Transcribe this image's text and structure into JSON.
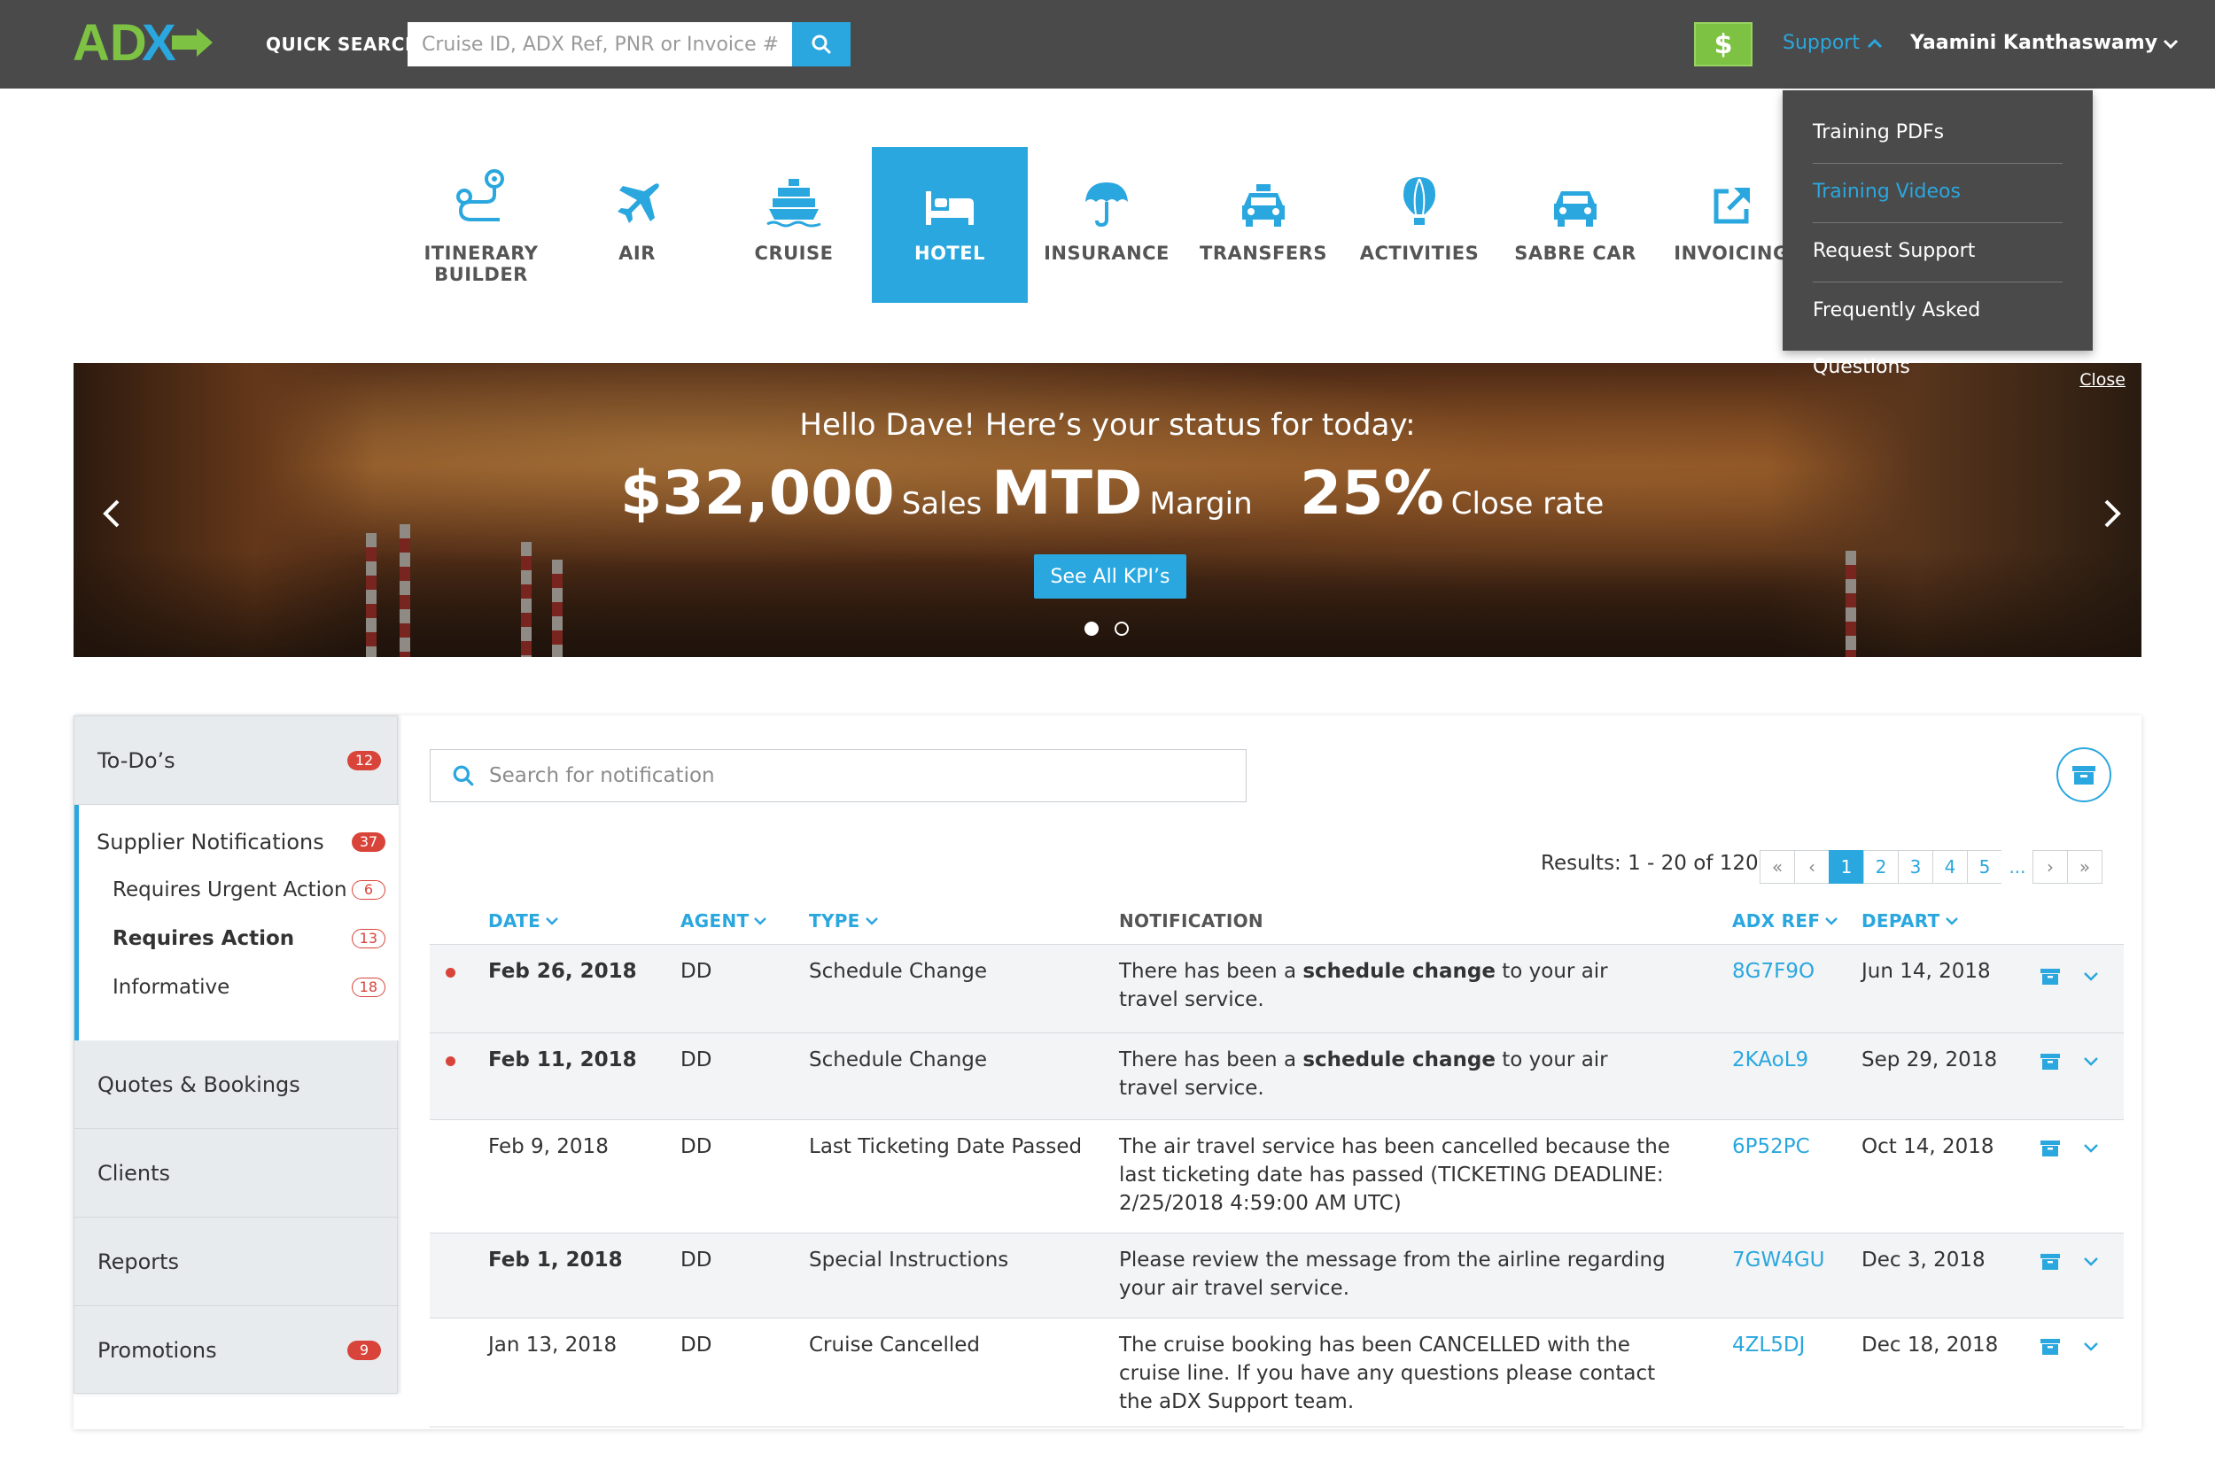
{
  "header": {
    "quick_search_label": "QUICK SEARCH",
    "quick_search_placeholder": "Cruise ID, ADX Ref, PNR or Invoice #",
    "dollar_label": "$",
    "support_label": "Support",
    "user_name": "Yaamini Kanthaswamy",
    "colors": {
      "bar": "#4a4a4a",
      "accent": "#2aa7de",
      "green": "#7dc242"
    }
  },
  "logo": {
    "text_ad": "AD",
    "text_x": "X"
  },
  "support_menu": {
    "items": [
      {
        "label": "Training PDFs",
        "active": false
      },
      {
        "label": "Training Videos",
        "active": true
      },
      {
        "label": "Request Support",
        "active": false
      },
      {
        "label": "Frequently Asked Questions",
        "active": false
      }
    ]
  },
  "categories": [
    {
      "label": "ITINERARY BUILDER",
      "icon": "route-icon"
    },
    {
      "label": "AIR",
      "icon": "airplane-icon"
    },
    {
      "label": "CRUISE",
      "icon": "ship-icon"
    },
    {
      "label": "HOTEL",
      "icon": "bed-icon",
      "active": true
    },
    {
      "label": "INSURANCE",
      "icon": "umbrella-icon"
    },
    {
      "label": "TRANSFERS",
      "icon": "taxi-icon"
    },
    {
      "label": "ACTIVITIES",
      "icon": "balloon-icon"
    },
    {
      "label": "SABRE CAR",
      "icon": "car-icon"
    },
    {
      "label": "INVOICING",
      "icon": "external-link-icon"
    }
  ],
  "banner": {
    "close_label": "Close",
    "greeting": "Hello Dave! Here’s your status for today:",
    "kpis": [
      {
        "value": "$32,000",
        "label": "Sales"
      },
      {
        "value": "MTD",
        "label": "Margin"
      },
      {
        "value": "25%",
        "label": "Close rate"
      }
    ],
    "button_label": "See All KPI’s",
    "slides": 2,
    "active_slide": 1
  },
  "sidebar": {
    "todos": {
      "label": "To-Do’s",
      "count": "12"
    },
    "supplier": {
      "label": "Supplier Notifications",
      "count": "37"
    },
    "sub_items": [
      {
        "label": "Requires Urgent Action",
        "count": "6",
        "bold": false
      },
      {
        "label": "Requires Action",
        "count": "13",
        "bold": true
      },
      {
        "label": "Informative",
        "count": "18",
        "bold": false
      }
    ],
    "quotes": {
      "label": "Quotes & Bookings"
    },
    "clients": {
      "label": "Clients"
    },
    "reports": {
      "label": "Reports"
    },
    "promotions": {
      "label": "Promotions",
      "count": "9"
    }
  },
  "notifications": {
    "search_placeholder": "Search for notification",
    "results_text": "Results: 1 - 20 of 120",
    "pager": {
      "first": "«",
      "prev": "‹",
      "pages": [
        "1",
        "2",
        "3",
        "4",
        "5"
      ],
      "active_page": "1",
      "ellipsis": "...",
      "next": "›",
      "last": "»"
    },
    "columns": {
      "date": "DATE",
      "agent": "AGENT",
      "type": "TYPE",
      "notification": "NOTIFICATION",
      "adx_ref": "ADX REF",
      "depart": "DEPART"
    },
    "rows": [
      {
        "unread": true,
        "date": "Feb 26, 2018",
        "agent": "DD",
        "type": "Schedule Change",
        "notif_pre": "There has been a ",
        "notif_bold": "schedule change",
        "notif_post": " to your air travel service.",
        "ref": "8G7F9O",
        "depart": "Jun 14, 2018"
      },
      {
        "unread": true,
        "date": "Feb 11, 2018",
        "agent": "DD",
        "type": "Schedule Change",
        "notif_pre": "There has been a ",
        "notif_bold": "schedule change",
        "notif_post": " to your air travel service.",
        "ref": "2KAoL9",
        "depart": "Sep 29, 2018"
      },
      {
        "unread": false,
        "date": "Feb 9, 2018",
        "agent": "DD",
        "type": "Last Ticketing Date Passed",
        "notif_pre": "The air travel service has been cancelled because the last ticketing date has passed (TICKETING DEADLINE: 2/25/2018 4:59:00 AM UTC)",
        "notif_bold": "",
        "notif_post": "",
        "ref": "6P52PC",
        "depart": "Oct 14, 2018"
      },
      {
        "unread": false,
        "bold_date": true,
        "shaded": true,
        "date": "Feb 1, 2018",
        "agent": "DD",
        "type": "Special Instructions",
        "notif_pre": "Please review the message from the airline regarding your air travel service.",
        "notif_bold": "",
        "notif_post": "",
        "ref": "7GW4GU",
        "depart": "Dec 3, 2018"
      },
      {
        "unread": false,
        "date": "Jan 13, 2018",
        "agent": "DD",
        "type": "Cruise Cancelled",
        "notif_pre": "The cruise booking has been CANCELLED with the cruise line. If you have any questions please contact the aDX Support team.",
        "notif_bold": "",
        "notif_post": "",
        "ref": "4ZL5DJ",
        "depart": "Dec 18, 2018"
      }
    ]
  }
}
